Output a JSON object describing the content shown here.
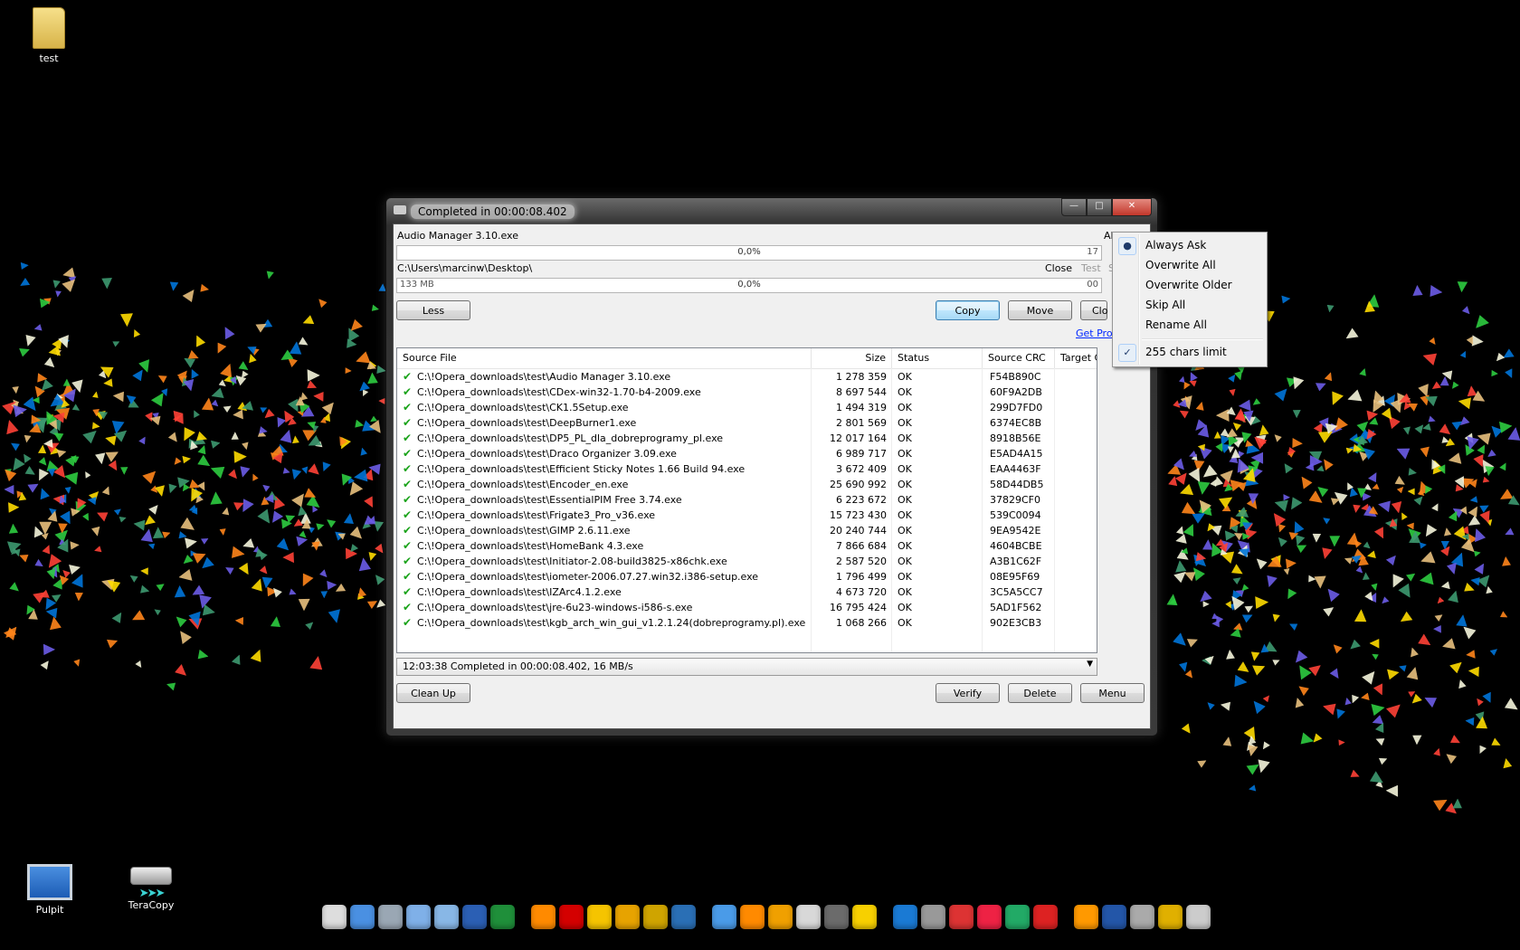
{
  "desktop": {
    "icons": [
      {
        "label": "test"
      },
      {
        "label": "Pulpit"
      },
      {
        "label": "TeraCopy"
      }
    ]
  },
  "window": {
    "title": "Completed in 00:00:08.402",
    "file_name": "Audio Manager 3.10.exe",
    "overwrite_label": "Alw",
    "file_progress": {
      "percent_text": "0,0%",
      "right_text": "17",
      "value": 0
    },
    "target_path": "C:\\Users\\marcinw\\Desktop\\",
    "close_label": "Close",
    "test_label": "Test",
    "sh_label": "Sh",
    "total_progress": {
      "left_text": "133 MB",
      "percent_text": "0,0%",
      "right_text": "00",
      "value": 0
    },
    "buttons": {
      "less": "Less",
      "copy": "Copy",
      "move": "Move",
      "close_partial": "Clo",
      "clean_up": "Clean Up",
      "verify": "Verify",
      "delete": "Delete",
      "menu": "Menu"
    },
    "get_pro_link": "Get Pro",
    "columns": [
      "Source File",
      "Size",
      "Status",
      "Source CRC",
      "Target CRC"
    ],
    "rows": [
      {
        "file": "C:\\!Opera_downloads\\test\\Audio Manager 3.10.exe",
        "size": "1 278 359",
        "status": "OK",
        "crc": "F54B890C"
      },
      {
        "file": "C:\\!Opera_downloads\\test\\CDex-win32-1.70-b4-2009.exe",
        "size": "8 697 544",
        "status": "OK",
        "crc": "60F9A2DB"
      },
      {
        "file": "C:\\!Opera_downloads\\test\\CK1.5Setup.exe",
        "size": "1 494 319",
        "status": "OK",
        "crc": "299D7FD0"
      },
      {
        "file": "C:\\!Opera_downloads\\test\\DeepBurner1.exe",
        "size": "2 801 569",
        "status": "OK",
        "crc": "6374EC8B"
      },
      {
        "file": "C:\\!Opera_downloads\\test\\DP5_PL_dla_dobreprogramy_pl.exe",
        "size": "12 017 164",
        "status": "OK",
        "crc": "8918B56E"
      },
      {
        "file": "C:\\!Opera_downloads\\test\\Draco Organizer 3.09.exe",
        "size": "6 989 717",
        "status": "OK",
        "crc": "E5AD4A15"
      },
      {
        "file": "C:\\!Opera_downloads\\test\\Efficient Sticky Notes 1.66 Build 94.exe",
        "size": "3 672 409",
        "status": "OK",
        "crc": "EAA4463F"
      },
      {
        "file": "C:\\!Opera_downloads\\test\\Encoder_en.exe",
        "size": "25 690 992",
        "status": "OK",
        "crc": "58D44DB5"
      },
      {
        "file": "C:\\!Opera_downloads\\test\\EssentialPIM Free 3.74.exe",
        "size": "6 223 672",
        "status": "OK",
        "crc": "37829CF0"
      },
      {
        "file": "C:\\!Opera_downloads\\test\\Frigate3_Pro_v36.exe",
        "size": "15 723 430",
        "status": "OK",
        "crc": "539C0094"
      },
      {
        "file": "C:\\!Opera_downloads\\test\\GIMP 2.6.11.exe",
        "size": "20 240 744",
        "status": "OK",
        "crc": "9EA9542E"
      },
      {
        "file": "C:\\!Opera_downloads\\test\\HomeBank 4.3.exe",
        "size": "7 866 684",
        "status": "OK",
        "crc": "4604BCBE"
      },
      {
        "file": "C:\\!Opera_downloads\\test\\Initiator-2.08-build3825-x86chk.exe",
        "size": "2 587 520",
        "status": "OK",
        "crc": "A3B1C62F"
      },
      {
        "file": "C:\\!Opera_downloads\\test\\iometer-2006.07.27.win32.i386-setup.exe",
        "size": "1 796 499",
        "status": "OK",
        "crc": "08E95F69"
      },
      {
        "file": "C:\\!Opera_downloads\\test\\IZArc4.1.2.exe",
        "size": "4 673 720",
        "status": "OK",
        "crc": "3C5A5CC7"
      },
      {
        "file": "C:\\!Opera_downloads\\test\\jre-6u23-windows-i586-s.exe",
        "size": "16 795 424",
        "status": "OK",
        "crc": "5AD1F562"
      },
      {
        "file": "C:\\!Opera_downloads\\test\\kgb_arch_win_gui_v1.2.1.24(dobreprogramy.pl).exe",
        "size": "1 068 266",
        "status": "OK",
        "crc": "902E3CB3"
      }
    ],
    "status_text": "12:03:38 Completed in 00:00:08.402, 16 MB/s"
  },
  "context_menu": {
    "items": [
      {
        "label": "Always Ask",
        "mark": "radio"
      },
      {
        "label": "Overwrite All",
        "mark": ""
      },
      {
        "label": "Overwrite Older",
        "mark": ""
      },
      {
        "label": "Skip All",
        "mark": ""
      },
      {
        "label": "Rename All",
        "mark": ""
      },
      {
        "label": "255 chars limit",
        "mark": "check"
      }
    ]
  },
  "colors": {
    "desktop_bg": "#000000",
    "check_green": "#1aa31a",
    "link_blue": "#0026ff",
    "close_red": "#c1362a"
  }
}
